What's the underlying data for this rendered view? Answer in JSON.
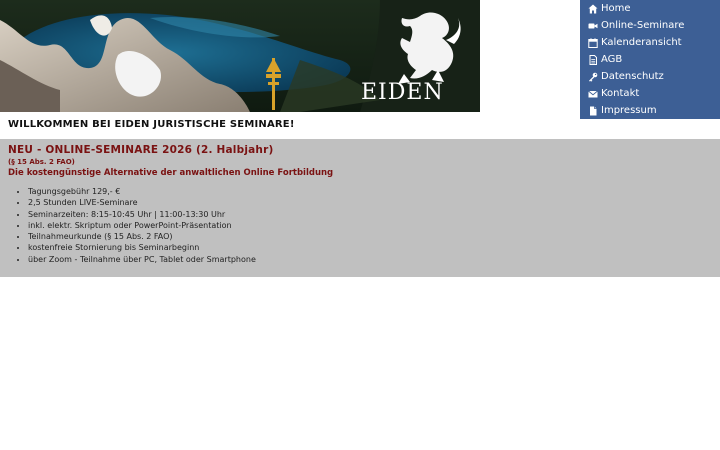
{
  "brand": {
    "logo_text": "EIDEN"
  },
  "nav": {
    "items": [
      {
        "label": "Home",
        "icon": "home-icon"
      },
      {
        "label": "Online-Seminare",
        "icon": "video-camera-icon"
      },
      {
        "label": "Kalenderansicht",
        "icon": "calendar-icon"
      },
      {
        "label": "AGB",
        "icon": "document-icon"
      },
      {
        "label": "Datenschutz",
        "icon": "key-icon"
      },
      {
        "label": "Kontakt",
        "icon": "envelope-icon"
      },
      {
        "label": "Impressum",
        "icon": "file-icon"
      }
    ]
  },
  "welcome": "WILLKOMMEN BEI EIDEN JURISTISCHE SEMINARE!",
  "seminar": {
    "title": "NEU - ONLINE-SEMINARE 2026 (2. Halbjahr)",
    "reference": "(§ 15 Abs. 2 FAO)",
    "subtitle": "Die kostengünstige Alternative der anwaltlichen Online Fortbildung",
    "features": [
      "Tagungsgebühr 129,- €",
      "2,5 Stunden LIVE-Seminare",
      "Seminarzeiten: 8:15-10:45 Uhr | 11:00-13:30 Uhr",
      "inkl. elektr. Skriptum oder PowerPoint-Präsentation",
      "Teilnahmeurkunde (§ 15 Abs. 2 FAO)",
      "kostenfreie Stornierung bis Seminarbeginn",
      "über Zoom - Teilnahme über PC, Tablet oder Smartphone"
    ]
  },
  "colors": {
    "nav_bg": "#3d5f95",
    "panel_bg": "#c0c0c0",
    "accent_red": "#7a1212"
  }
}
